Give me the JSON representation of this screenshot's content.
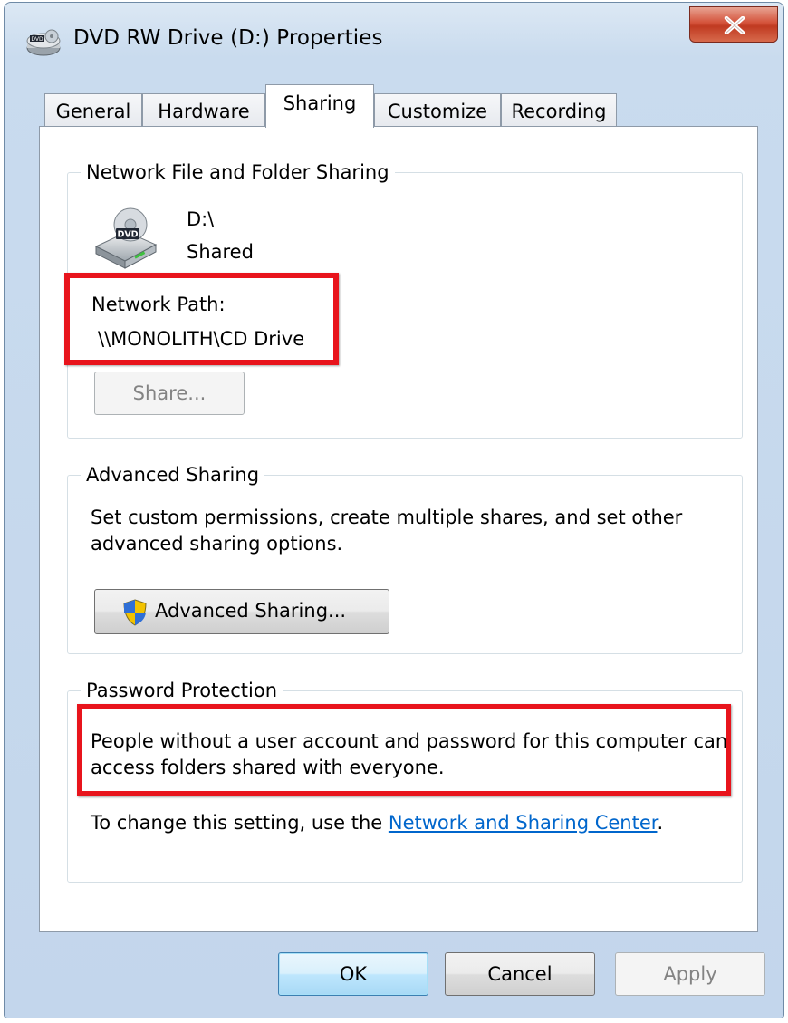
{
  "window": {
    "title": "DVD RW Drive (D:) Properties",
    "close_label": "X"
  },
  "tabs": [
    {
      "label": "General",
      "active": false
    },
    {
      "label": "Hardware",
      "active": false
    },
    {
      "label": "Sharing",
      "active": true
    },
    {
      "label": "Customize",
      "active": false
    },
    {
      "label": "Recording",
      "active": false
    }
  ],
  "network_sharing": {
    "group_label": "Network File and Folder Sharing",
    "drive_icon_label": "DVD",
    "drive_name": "D:\\",
    "share_status": "Shared",
    "network_path_label": "Network Path:",
    "network_path_value": "\\\\MONOLITH\\CD Drive",
    "share_button": "Share..."
  },
  "advanced_sharing": {
    "group_label": "Advanced Sharing",
    "description": "Set custom permissions, create multiple shares, and set other advanced sharing options.",
    "button_label": "Advanced Sharing..."
  },
  "password_protection": {
    "group_label": "Password Protection",
    "description": "People without a user account and password for this computer can access folders shared with everyone.",
    "change_prefix": "To change this setting, use the ",
    "link_text": "Network and Sharing Center",
    "change_suffix": "."
  },
  "footer": {
    "ok": "OK",
    "cancel": "Cancel",
    "apply": "Apply"
  },
  "colors": {
    "highlight": "#e8141c",
    "link": "#0066cc",
    "title_gradient": "#c9dbee"
  }
}
